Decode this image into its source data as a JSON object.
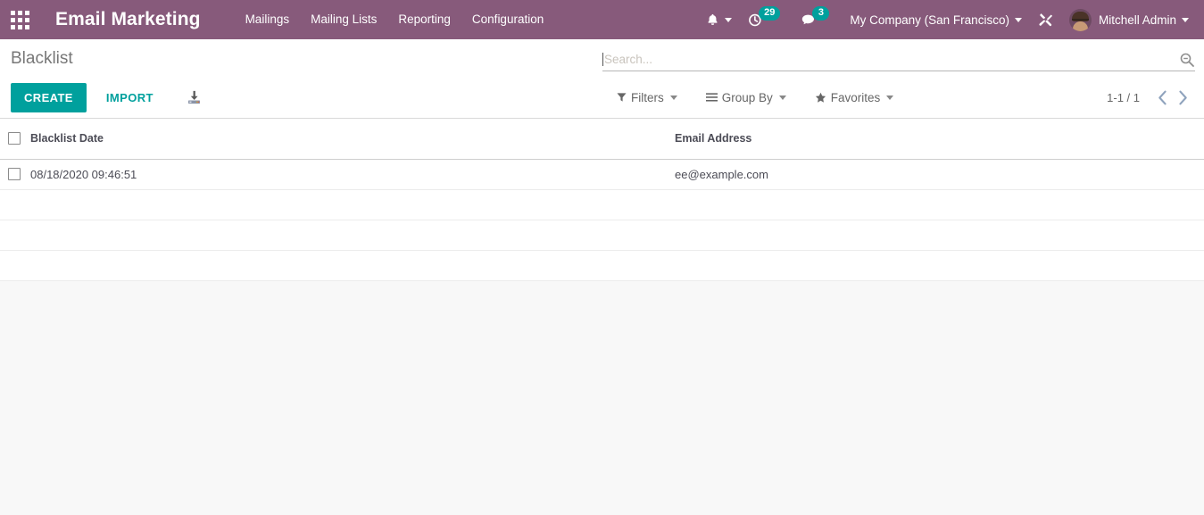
{
  "navbar": {
    "apps_icon": "apps-grid-icon",
    "brand": "Email Marketing",
    "menu_items": [
      {
        "label": "Mailings"
      },
      {
        "label": "Mailing Lists"
      },
      {
        "label": "Reporting"
      },
      {
        "label": "Configuration"
      }
    ],
    "bell_icon": "bell-icon",
    "activity": {
      "icon": "clock-activity-icon",
      "count": "29"
    },
    "messaging": {
      "icon": "chat-bubble-icon",
      "count": "3"
    },
    "company": "My Company (San Francisco)",
    "debug_icon": "wrench-screwdriver-icon",
    "user": "Mitchell Admin",
    "avatar": "user-avatar",
    "colors": {
      "navbar_bg": "#875A7B",
      "badge_bg": "#00A09D",
      "text": "#FFFFFF"
    }
  },
  "control_panel": {
    "breadcrumb": "Blacklist",
    "create_label": "CREATE",
    "import_label": "IMPORT",
    "download_icon": "download-icon",
    "search": {
      "value": "",
      "placeholder": "Search...",
      "icon": "search-icon"
    },
    "filter_buttons": [
      {
        "label": "Filters",
        "icon": "filter-funnel-icon"
      },
      {
        "label": "Group By",
        "icon": "hamburger-lines-icon"
      },
      {
        "label": "Favorites",
        "icon": "star-icon"
      }
    ],
    "pager": {
      "count": "1-1 / 1",
      "prev_icon": "chevron-left-icon",
      "next_icon": "chevron-right-icon"
    },
    "colors": {
      "primary": "#00A09D",
      "breadcrumb_text": "#777777"
    }
  },
  "list": {
    "select_all_checkbox": "unchecked",
    "columns": [
      {
        "label": "Blacklist Date"
      },
      {
        "label": "Email Address"
      }
    ],
    "rows": [
      {
        "checkbox": "unchecked",
        "blacklist_date": "08/18/2020 09:46:51",
        "email_address": "ee@example.com"
      }
    ],
    "empty_filler_rows": 3
  }
}
